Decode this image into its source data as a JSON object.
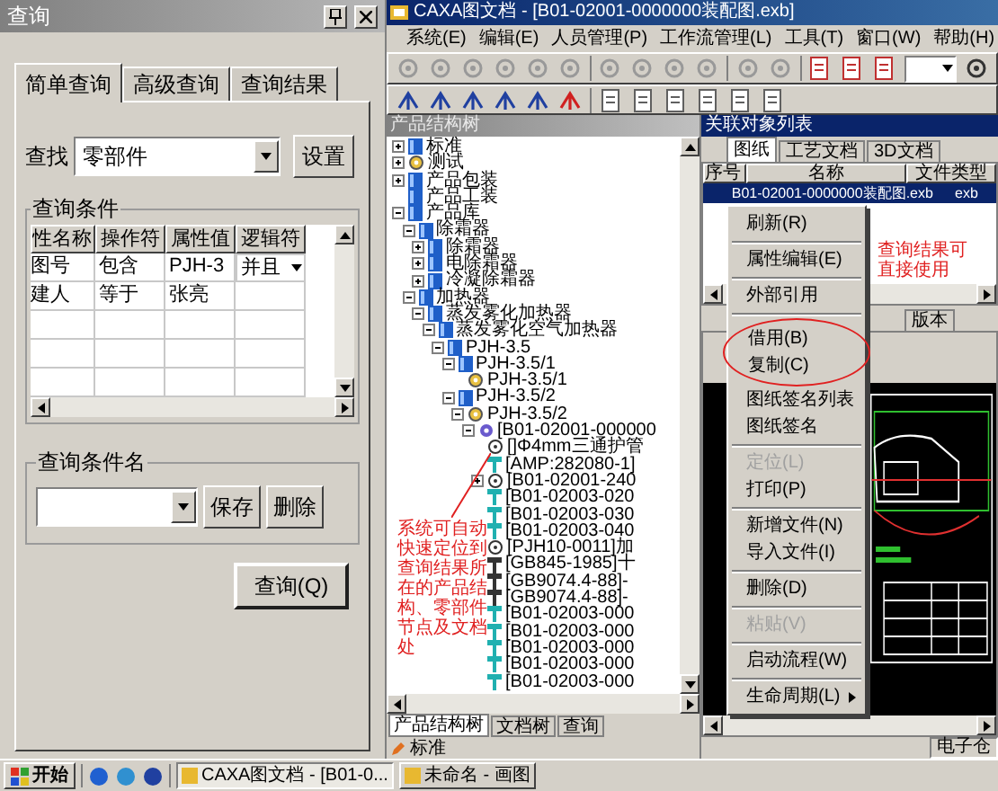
{
  "query_panel": {
    "title": "查询",
    "tabs": [
      {
        "label": "简单查询",
        "selected": true
      },
      {
        "label": "高级查询",
        "selected": false
      },
      {
        "label": "查询结果",
        "selected": false
      }
    ],
    "find_label": "查找",
    "find_value": "零部件",
    "settings_button": "设置",
    "conditions": {
      "title": "查询条件",
      "columns": [
        "性名称",
        "操作符",
        "属性值",
        "逻辑符"
      ],
      "rows": [
        {
          "attribute": "图号",
          "operator": "包含",
          "value": "PJH-3",
          "logic": "并且"
        },
        {
          "attribute": "建人",
          "operator": "等于",
          "value": "张亮"
        }
      ]
    },
    "saved": {
      "title": "查询条件名",
      "buttons": [
        "保存",
        "删除"
      ]
    },
    "query_button": "查询(Q)"
  },
  "app_window": {
    "title": "CAXA图文档 - [B01-02001-0000000装配图.exb]",
    "menu": [
      "系统(E)",
      "编辑(E)",
      "人员管理(P)",
      "工作流管理(L)",
      "工具(T)",
      "窗口(W)",
      "帮助(H)"
    ],
    "tree_pane": {
      "title": "产品结构树",
      "tree": [
        {
          "label": "标准",
          "kind": "category",
          "expanded": false
        },
        {
          "label": "测试",
          "kind": "product",
          "expanded": false
        },
        {
          "label": "产品包装",
          "kind": "category",
          "expanded": false
        },
        {
          "label": "产品工装",
          "kind": "category"
        },
        {
          "label": "产品库",
          "kind": "category",
          "expanded": true,
          "children": [
            {
              "label": "除霜器",
              "kind": "category",
              "expanded": true,
              "children": [
                {
                  "label": "除霜器",
                  "kind": "category",
                  "expanded": false
                },
                {
                  "label": "电除霜器",
                  "kind": "category",
                  "expanded": false
                },
                {
                  "label": "冷凝除霜器",
                  "kind": "category",
                  "expanded": false
                }
              ]
            },
            {
              "label": "加热器",
              "kind": "category",
              "expanded": true,
              "children": [
                {
                  "label": "蒸发雾化加热器",
                  "kind": "category",
                  "expanded": true,
                  "children": [
                    {
                      "label": "蒸发雾化空气加热器",
                      "kind": "category",
                      "expanded": true,
                      "children": [
                        {
                          "label": "PJH-3.5",
                          "kind": "category",
                          "expanded": true,
                          "children": [
                            {
                              "label": "PJH-3.5/1",
                              "kind": "category",
                              "expanded": true,
                              "children": [
                                {
                                  "label": "PJH-3.5/1",
                                  "kind": "product"
                                }
                              ]
                            },
                            {
                              "label": "PJH-3.5/2",
                              "kind": "category",
                              "expanded": true,
                              "children": [
                                {
                                  "label": "PJH-3.5/2",
                                  "kind": "product",
                                  "expanded": true,
                                  "children": [
                                    {
                                      "label": "[B01-02001-000000",
                                      "kind": "assembly",
                                      "expanded": true,
                                      "children": [
                                        {
                                          "label": "[]Φ4mm三通护管",
                                          "kind": "component"
                                        },
                                        {
                                          "label": "[AMP:282080-1]",
                                          "kind": "part"
                                        },
                                        {
                                          "label": "[B01-02001-240",
                                          "kind": "component",
                                          "expanded": false
                                        },
                                        {
                                          "label": "[B01-02003-020",
                                          "kind": "part"
                                        },
                                        {
                                          "label": "[B01-02003-030",
                                          "kind": "part"
                                        },
                                        {
                                          "label": "[B01-02003-040",
                                          "kind": "part"
                                        },
                                        {
                                          "label": "[PJH10-0011]加",
                                          "kind": "component"
                                        },
                                        {
                                          "label": "[GB845-1985]十",
                                          "kind": "standard"
                                        },
                                        {
                                          "label": "[GB9074.4-88]-",
                                          "kind": "standard"
                                        },
                                        {
                                          "label": "[GB9074.4-88]-",
                                          "kind": "standard"
                                        },
                                        {
                                          "label": "[B01-02003-000",
                                          "kind": "part"
                                        },
                                        {
                                          "label": "[B01-02003-000",
                                          "kind": "part"
                                        },
                                        {
                                          "label": "[B01-02003-000",
                                          "kind": "part"
                                        },
                                        {
                                          "label": "[B01-02003-000",
                                          "kind": "part"
                                        },
                                        {
                                          "label": "[B01-02003-000",
                                          "kind": "part"
                                        }
                                      ]
                                    }
                                  ]
                                }
                              ]
                            }
                          ]
                        }
                      ]
                    }
                  ]
                }
              ]
            }
          ]
        }
      ]
    },
    "tree_note": "系统可自动快速定位到查询结果所在的产品结构、零部件节点及文档处",
    "bottom_tabs": [
      {
        "label": "产品结构树",
        "selected": true
      },
      {
        "label": "文档树",
        "selected": false
      },
      {
        "label": "查询",
        "selected": false
      }
    ],
    "toolbar_label": "标准",
    "related": {
      "title": "关联对象列表",
      "tabs": [
        {
          "label": "图纸",
          "selected": true
        },
        {
          "label": "工艺文档",
          "selected": false
        },
        {
          "label": "3D文档",
          "selected": false
        }
      ],
      "columns": [
        "序号",
        "名称",
        "文件类型"
      ],
      "rows": [
        {
          "name": "B01-02001-0000000装配图.exb",
          "type": "exb",
          "selected": true
        }
      ]
    },
    "result_note": "查询结果可直接使用",
    "preview_tab": "版本",
    "status": "电子仓",
    "context_menu": [
      {
        "label": "刷新(R)",
        "disabled": false,
        "separator_after": true,
        "submenu": false
      },
      {
        "label": "属性编辑(E)",
        "disabled": false,
        "separator_after": true,
        "submenu": false
      },
      {
        "label": "外部引用",
        "disabled": false,
        "separator_after": true,
        "submenu": false
      },
      {
        "label": "借用(B)",
        "disabled": false,
        "separator_after": false,
        "submenu": false,
        "highlighted": true
      },
      {
        "label": "复制(C)",
        "disabled": false,
        "separator_after": false,
        "submenu": false,
        "highlighted": true
      },
      {
        "label": "图纸签名列表",
        "disabled": false,
        "separator_after": false,
        "submenu": false
      },
      {
        "label": "图纸签名",
        "disabled": false,
        "separator_after": true,
        "submenu": false
      },
      {
        "label": "定位(L)",
        "disabled": true,
        "separator_after": false,
        "submenu": false
      },
      {
        "label": "打印(P)",
        "disabled": false,
        "separator_after": true,
        "submenu": false
      },
      {
        "label": "新增文件(N)",
        "disabled": false,
        "separator_after": false,
        "submenu": false
      },
      {
        "label": "导入文件(I)",
        "disabled": false,
        "separator_after": true,
        "submenu": false
      },
      {
        "label": "删除(D)",
        "disabled": false,
        "separator_after": true,
        "submenu": false
      },
      {
        "label": "粘贴(V)",
        "disabled": true,
        "separator_after": true,
        "submenu": false
      },
      {
        "label": "启动流程(W)",
        "disabled": false,
        "separator_after": true,
        "submenu": false
      },
      {
        "label": "生命周期(L)",
        "disabled": false,
        "separator_after": false,
        "submenu": true
      }
    ]
  },
  "taskbar": {
    "start": "开始",
    "tasks": [
      {
        "label": "CAXA图文档 - [B01-0...",
        "selected": true
      },
      {
        "label": "未命名 - 画图",
        "selected": false
      }
    ]
  }
}
